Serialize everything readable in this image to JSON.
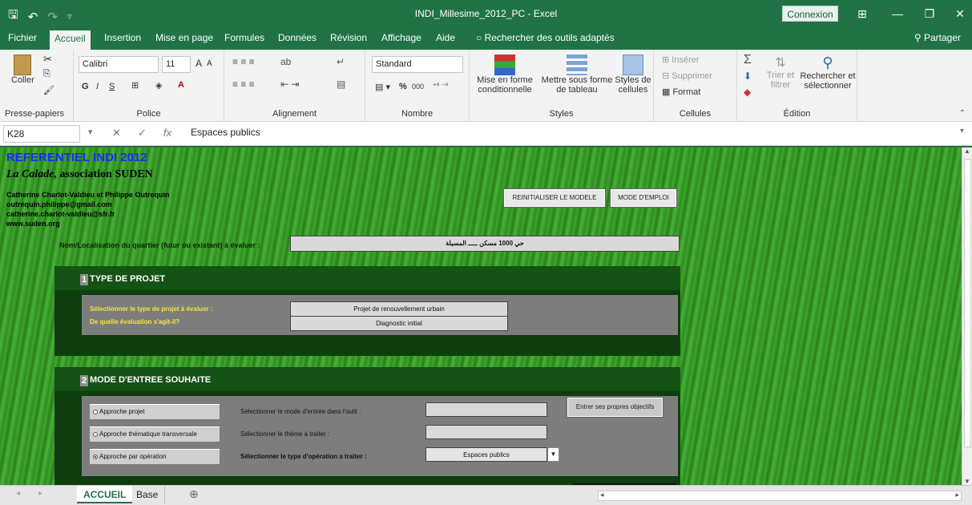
{
  "window": {
    "title": "INDI_Millesime_2012_PC  -  Excel",
    "connexion": "Connexion",
    "minimize": "—",
    "restore": "❐",
    "close": "✕",
    "layout_icon": "⊞"
  },
  "quick_access": {
    "save": "🖫",
    "undo": "↶",
    "redo": "↷",
    "customize": "▿"
  },
  "ribbon_tabs": [
    "Fichier",
    "Accueil",
    "Insertion",
    "Mise en page",
    "Formules",
    "Données",
    "Révision",
    "Affichage",
    "Aide"
  ],
  "tell_me": "Rechercher des outils adaptés",
  "share": "Partager",
  "ribbon": {
    "clipboard": {
      "paste": "Coller",
      "label": "Presse-papiers"
    },
    "font": {
      "name": "Calibri",
      "size": "11",
      "label": "Police",
      "bold": "G",
      "italic": "I",
      "underline": "S",
      "grow": "A",
      "shrink": "A"
    },
    "alignment": {
      "label": "Alignement"
    },
    "number": {
      "format": "Standard",
      "percent": "%",
      "thousands": "000",
      "label": "Nombre"
    },
    "styles": {
      "conditional": "Mise en forme conditionnelle",
      "table": "Mettre sous forme de tableau",
      "cell": "Styles de cellules",
      "label": "Styles"
    },
    "cells": {
      "insert": "Insérer",
      "delete": "Supprimer",
      "format": "Format",
      "label": "Cellules"
    },
    "editing": {
      "sort": "Trier et filtrer",
      "find": "Rechercher et sélectionner",
      "label": "Édition"
    }
  },
  "formula_bar": {
    "cell": "K28",
    "cancel": "✕",
    "enter": "✓",
    "fx": "fx",
    "value": "Espaces publics"
  },
  "sheet": {
    "title": "REFERENTIEL INDI 2012",
    "calade": "La Calade,",
    "assoc": " association SUDEN",
    "authors": [
      "Catherine Charlot-Valdieu et Philippe Outrequin",
      "outrequin.philippe@gmail.com",
      "catherine.charlot-valdieu@sfr.fr",
      "www.suden.org"
    ],
    "reset_button": "REINITIALISER LE MODELE",
    "help_button": "MODE D'EMPLOI",
    "location_label": "Nom/Localisation du quartier (futur ou existant) à évaluer :",
    "location_value": "حي 1000 مسكن ـــــ المسيلة",
    "section1": {
      "number": "1",
      "title": "TYPE DE PROJET",
      "q1": "Sélectionner le type de projet à évaluer :",
      "a1": "Projet de renouvellement urbain",
      "q2": "De quelle évaluation s'agit-il?",
      "a2": "Diagnostic initial"
    },
    "section2": {
      "number": "2",
      "title": "MODE D'ENTREE SOUHAITE",
      "radios": [
        {
          "label": "Approche projet",
          "checked": false
        },
        {
          "label": "Approche thématique transversale",
          "checked": false
        },
        {
          "label": "Approche par opération",
          "checked": true
        }
      ],
      "mode_label": "Sélectionner le mode d'entrée dans l'outil :",
      "theme_label": "Sélectionner le thème à traiter :",
      "operation_label": "Sélectionner le type d'opération a traiter :",
      "operation_value": "Espaces publics",
      "objectives_button": "Entrer ses propres objectifs"
    }
  },
  "sheet_tabs": [
    "ACCUEIL",
    "Base"
  ],
  "add_sheet": "⊕"
}
